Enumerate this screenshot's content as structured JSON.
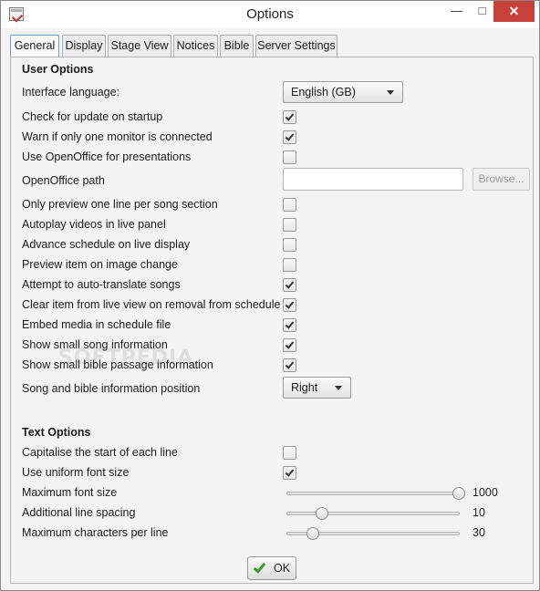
{
  "window": {
    "title": "Options"
  },
  "title_controls": {
    "minimize": "—",
    "maximize": "□",
    "close": "✕"
  },
  "tabs": [
    {
      "label": "General",
      "active": true
    },
    {
      "label": "Display",
      "active": false
    },
    {
      "label": "Stage View",
      "active": false
    },
    {
      "label": "Notices",
      "active": false
    },
    {
      "label": "Bible",
      "active": false
    },
    {
      "label": "Server Settings",
      "active": false
    }
  ],
  "user_options": {
    "heading": "User Options",
    "interface_language": {
      "label": "Interface language:",
      "value": "English (GB)"
    },
    "check_update": {
      "label": "Check for update on startup",
      "checked": true
    },
    "warn_monitor": {
      "label": "Warn if only one monitor is connected",
      "checked": true
    },
    "use_openoffice": {
      "label": "Use OpenOffice for presentations",
      "checked": false
    },
    "openoffice_path": {
      "label": "OpenOffice path",
      "value": "",
      "browse_label": "Browse..."
    },
    "preview_one_line": {
      "label": "Only preview one line per song section",
      "checked": false
    },
    "autoplay_videos": {
      "label": "Autoplay videos in live panel",
      "checked": false
    },
    "advance_schedule": {
      "label": "Advance schedule on live display",
      "checked": false
    },
    "preview_image_change": {
      "label": "Preview item on image change",
      "checked": false
    },
    "auto_translate": {
      "label": "Attempt to auto-translate songs",
      "checked": true
    },
    "clear_live_view": {
      "label": "Clear item from live view on removal from schedule",
      "checked": true
    },
    "embed_media": {
      "label": "Embed media in schedule file",
      "checked": true
    },
    "small_song_info": {
      "label": "Show small song information",
      "checked": true
    },
    "small_bible_info": {
      "label": "Show small bible passage information",
      "checked": true
    },
    "info_position": {
      "label": "Song and bible information position",
      "value": "Right"
    }
  },
  "text_options": {
    "heading": "Text Options",
    "capitalise": {
      "label": "Capitalise the start of each line",
      "checked": false
    },
    "uniform_font": {
      "label": "Use uniform font size",
      "checked": true
    },
    "max_font_size": {
      "label": "Maximum font size",
      "value": "1000",
      "fraction": 1.0
    },
    "line_spacing": {
      "label": "Additional line spacing",
      "value": "10",
      "fraction": 0.2
    },
    "max_chars": {
      "label": "Maximum characters per line",
      "value": "30",
      "fraction": 0.15
    }
  },
  "footer": {
    "ok_label": "OK"
  },
  "watermark": "SOFTPEDIA"
}
